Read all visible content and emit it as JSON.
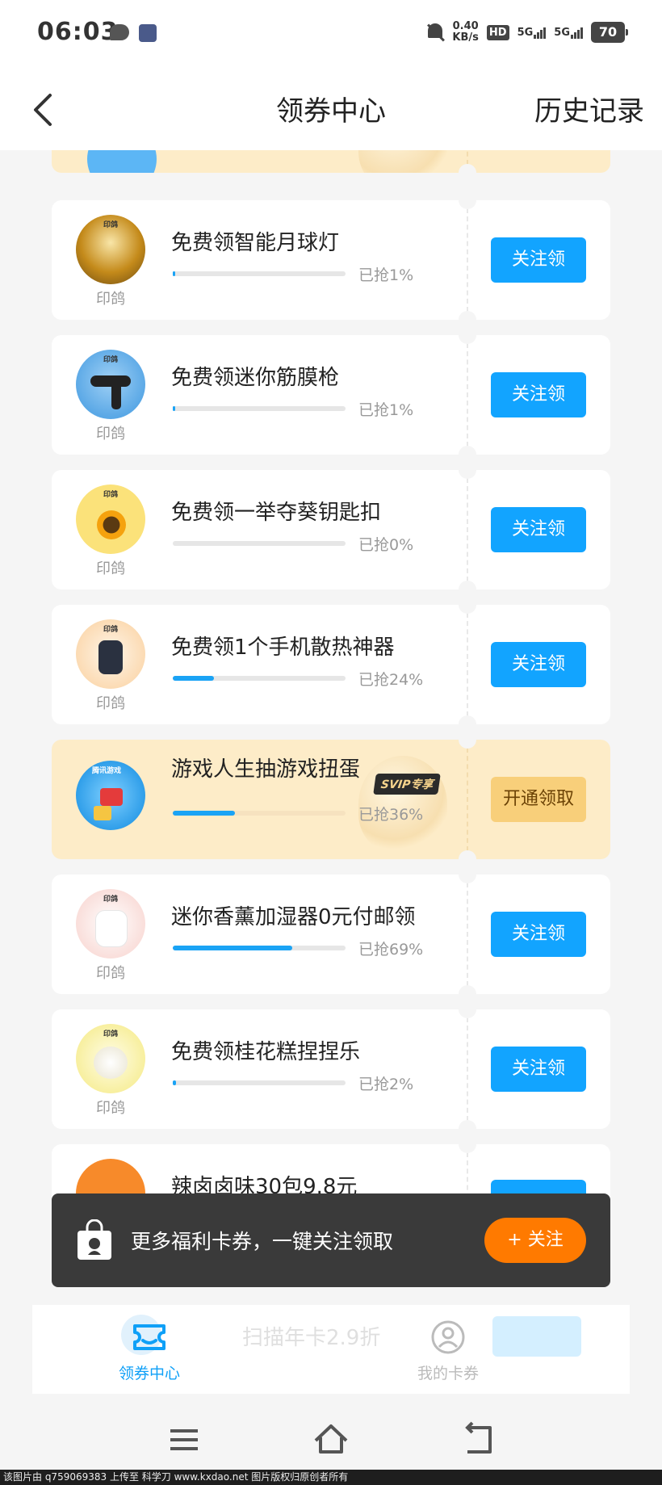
{
  "status_bar": {
    "time": "06:03",
    "net_speed_value": "0.40",
    "net_speed_unit": "KB/s",
    "hd_label": "HD",
    "signal1": "5G",
    "signal2": "5G",
    "battery": "70"
  },
  "header": {
    "title": "领券中心",
    "history": "历史记录"
  },
  "items": [
    {
      "title": "免费领智能月球灯",
      "brand": "印鸽",
      "progress_text": "已抢1%",
      "progress": 0.01,
      "button": "关注领",
      "thumb_tag": "印鸽"
    },
    {
      "title": "免费领迷你筋膜枪",
      "brand": "印鸽",
      "progress_text": "已抢1%",
      "progress": 0.01,
      "button": "关注领",
      "thumb_tag": "印鸽"
    },
    {
      "title": "免费领一举夺葵钥匙扣",
      "brand": "印鸽",
      "progress_text": "已抢0%",
      "progress": 0.0,
      "button": "关注领",
      "thumb_tag": "印鸽"
    },
    {
      "title": "免费领1个手机散热神器",
      "brand": "印鸽",
      "progress_text": "已抢24%",
      "progress": 0.24,
      "button": "关注领",
      "thumb_tag": "印鸽"
    },
    {
      "title": "游戏人生抽游戏扭蛋",
      "brand": "",
      "progress_text": "已抢36%",
      "progress": 0.36,
      "button": "开通领取",
      "badge": "SVIP专享",
      "thumb_tag": "腾讯游戏"
    },
    {
      "title": "迷你香薰加湿器0元付邮领",
      "brand": "印鸽",
      "progress_text": "已抢69%",
      "progress": 0.69,
      "button": "关注领",
      "thumb_tag": "印鸽"
    },
    {
      "title": "免费领桂花糕捏捏乐",
      "brand": "印鸽",
      "progress_text": "已抢2%",
      "progress": 0.02,
      "button": "关注领",
      "thumb_tag": "印鸽"
    },
    {
      "title": "辣卤卤味30包9.8元",
      "brand": "",
      "progress_text": "",
      "progress": 0.0,
      "button": "",
      "thumb_tag": ""
    }
  ],
  "faded_item": {
    "title": "扫描年卡2.9折"
  },
  "promo": {
    "text": "更多福利卡券，一键关注领取",
    "button": "+ 关注"
  },
  "tabs": {
    "coupon_center": "领券中心",
    "my_cards": "我的卡券"
  },
  "colors": {
    "accent_blue": "#12a4ff",
    "vip_gold": "#f8cf7a",
    "orange": "#ff7a00"
  },
  "watermark": "该图片由 q759069383 上传至 科学刀 www.kxdao.net 图片版权归原创者所有"
}
